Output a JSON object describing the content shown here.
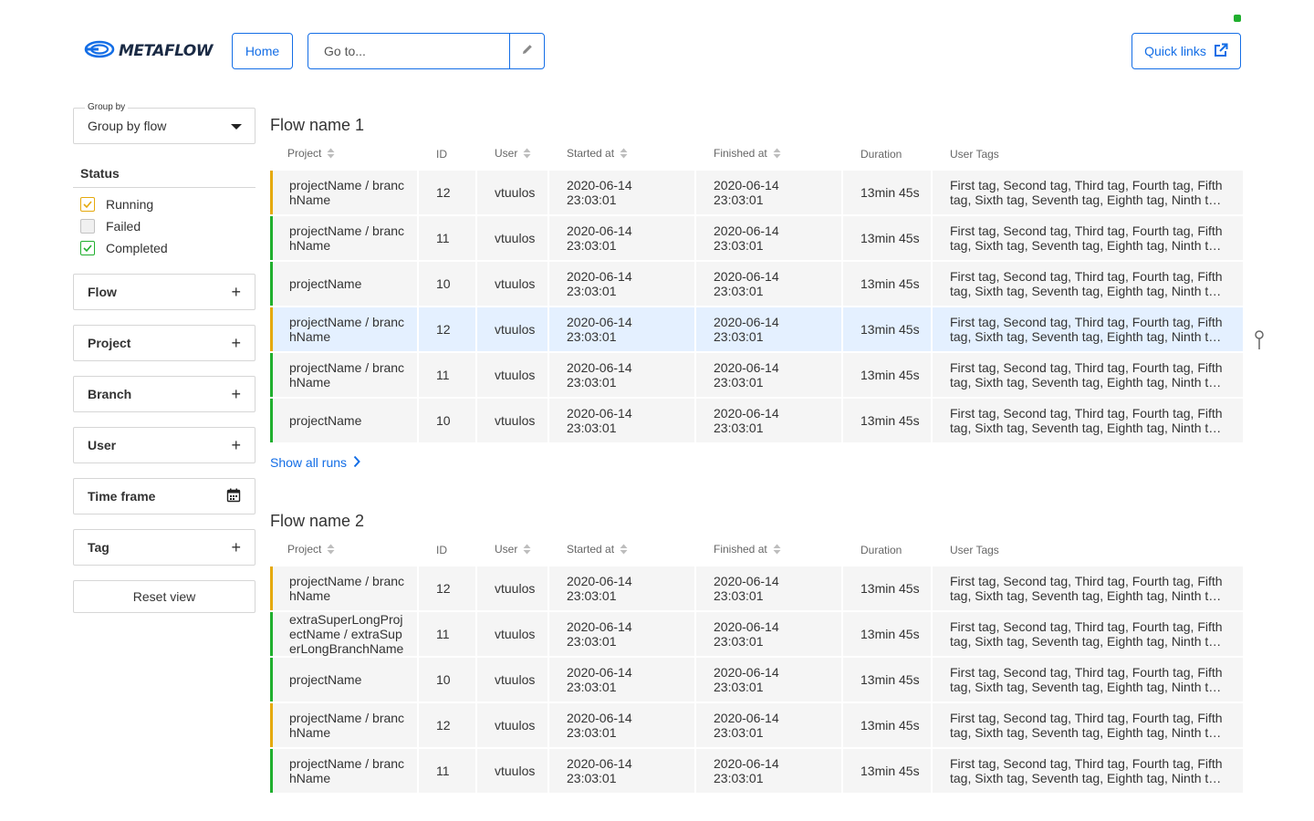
{
  "header": {
    "logo_text": "METAFLOW",
    "home_label": "Home",
    "goto_placeholder": "Go to...",
    "quick_links_label": "Quick links"
  },
  "sidebar": {
    "group_by_legend": "Group by",
    "group_by_value": "Group by flow",
    "status_title": "Status",
    "statuses": [
      {
        "label": "Running",
        "checked": true,
        "color": "#e5a90d"
      },
      {
        "label": "Failed",
        "checked": false,
        "color": "#c2c2c2"
      },
      {
        "label": "Completed",
        "checked": true,
        "color": "#20af2e"
      }
    ],
    "filters": [
      "Flow",
      "Project",
      "Branch",
      "User",
      "Time frame",
      "Tag"
    ],
    "reset_label": "Reset view"
  },
  "columns": [
    "Project",
    "ID",
    "User",
    "Started at",
    "Finished at",
    "Duration",
    "User Tags"
  ],
  "sections": [
    {
      "title": "Flow name 1",
      "show_all": "Show all runs",
      "rows": [
        {
          "status": "running",
          "project": "projectName / branchName",
          "id": "12",
          "user": "vtuulos",
          "started": "2020-06-14 23:03:01",
          "finished": "2020-06-14 23:03:01",
          "duration": "13min 45s",
          "tags": "First tag, Second tag, Third tag, Fourth tag, Fifth tag, Sixth tag, Seventh tag, Eighth tag, Ninth tag, Tenth tag"
        },
        {
          "status": "completed",
          "project": "projectName / branchName",
          "id": "11",
          "user": "vtuulos",
          "started": "2020-06-14 23:03:01",
          "finished": "2020-06-14 23:03:01",
          "duration": "13min 45s",
          "tags": "First tag, Second tag, Third tag, Fourth tag, Fifth tag, Sixth tag, Seventh tag, Eighth tag, Ninth tag, Tenth tag"
        },
        {
          "status": "completed",
          "project": "projectName",
          "id": "10",
          "user": "vtuulos",
          "started": "2020-06-14 23:03:01",
          "finished": "2020-06-14 23:03:01",
          "duration": "13min 45s",
          "tags": "First tag, Second tag, Third tag, Fourth tag, Fifth tag, Sixth tag, Seventh tag, Eighth tag, Ninth tag, Tenth tag"
        },
        {
          "status": "running",
          "highlight": true,
          "project": "projectName / branchName",
          "id": "12",
          "user": "vtuulos",
          "started": "2020-06-14 23:03:01",
          "finished": "2020-06-14 23:03:01",
          "duration": "13min 45s",
          "tags": "First tag, Second tag, Third tag, Fourth tag, Fifth tag, Sixth tag, Seventh tag, Eighth tag, Ninth tag, Tenth tag"
        },
        {
          "status": "completed",
          "project": "projectName / branchName",
          "id": "11",
          "user": "vtuulos",
          "started": "2020-06-14 23:03:01",
          "finished": "2020-06-14 23:03:01",
          "duration": "13min 45s",
          "tags": "First tag, Second tag, Third tag, Fourth tag, Fifth tag, Sixth tag, Seventh tag, Eighth tag, Ninth tag, Tenth tag"
        },
        {
          "status": "completed",
          "project": "projectName",
          "id": "10",
          "user": "vtuulos",
          "started": "2020-06-14 23:03:01",
          "finished": "2020-06-14 23:03:01",
          "duration": "13min 45s",
          "tags": "First tag, Second tag, Third tag, Fourth tag, Fifth tag, Sixth tag, Seventh tag, Eighth tag, Ninth tag, Tenth tag"
        }
      ]
    },
    {
      "title": "Flow name 2",
      "rows": [
        {
          "status": "running",
          "project": "projectName / branchName",
          "id": "12",
          "user": "vtuulos",
          "started": "2020-06-14 23:03:01",
          "finished": "2020-06-14 23:03:01",
          "duration": "13min 45s",
          "tags": "First tag, Second tag, Third tag, Fourth tag, Fifth tag, Sixth tag, Seventh tag, Eighth tag, Ninth tag, Tenth tag"
        },
        {
          "status": "completed",
          "project": "extraSuperLongProjectName / extraSuperLongBranchName",
          "id": "11",
          "user": "vtuulos",
          "started": "2020-06-14 23:03:01",
          "finished": "2020-06-14 23:03:01",
          "duration": "13min 45s",
          "tags": "First tag, Second tag, Third tag, Fourth tag, Fifth tag, Sixth tag, Seventh tag, Eighth tag, Ninth tag, Tenth tag"
        },
        {
          "status": "completed",
          "project": "projectName",
          "id": "10",
          "user": "vtuulos",
          "started": "2020-06-14 23:03:01",
          "finished": "2020-06-14 23:03:01",
          "duration": "13min 45s",
          "tags": "First tag, Second tag, Third tag, Fourth tag, Fifth tag, Sixth tag, Seventh tag, Eighth tag, Ninth tag, Tenth tag"
        },
        {
          "status": "running",
          "project": "projectName / branchName",
          "id": "12",
          "user": "vtuulos",
          "started": "2020-06-14 23:03:01",
          "finished": "2020-06-14 23:03:01",
          "duration": "13min 45s",
          "tags": "First tag, Second tag, Third tag, Fourth tag, Fifth tag, Sixth tag, Seventh tag, Eighth tag, Ninth tag, Tenth tag"
        },
        {
          "status": "completed",
          "project": "projectName / branchName",
          "id": "11",
          "user": "vtuulos",
          "started": "2020-06-14 23:03:01",
          "finished": "2020-06-14 23:03:01",
          "duration": "13min 45s",
          "tags": "First tag, Second tag, Third tag, Fourth tag, Fifth tag, Sixth tag, Seventh tag, Eighth tag, Ninth tag, Tenth tag"
        }
      ]
    }
  ],
  "icons": {
    "logo": "metaflow-logo-icon",
    "edit": "pencil-icon",
    "external": "external-link-icon",
    "caret": "caret-down-icon",
    "plus": "plus-icon",
    "calendar": "calendar-icon",
    "sort": "sort-icon",
    "chevron": "chevron-right-icon",
    "pin": "pin-icon"
  },
  "colors": {
    "accent": "#146ee6",
    "running": "#e5a90d",
    "completed": "#20af2e",
    "highlight_row": "#e4f0ff"
  }
}
